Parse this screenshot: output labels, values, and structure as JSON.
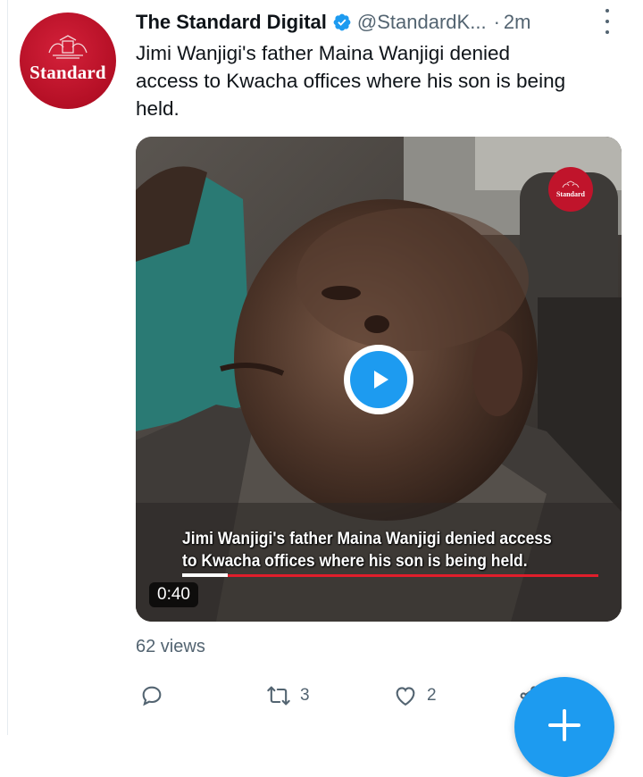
{
  "tweet": {
    "author_name": "The Standard Digital",
    "author_handle": "@StandardK...",
    "separator": "·",
    "time_ago": "2m",
    "avatar_text": "Standard",
    "text": "Jimi Wanjigi's father Maina Wanjigi denied\naccess to Kwacha offices where his son is being\nheld.",
    "views": "62 views"
  },
  "video": {
    "watermark_text": "Standard",
    "caption": "Jimi Wanjigi's father Maina Wanjigi denied access\nto Kwacha offices where his son is being held.",
    "duration": "0:40",
    "progress_fraction": 0.11
  },
  "actions": {
    "reply_count": "",
    "retweet_count": "3",
    "like_count": "2"
  },
  "icons": [
    "verified-icon",
    "more-icon",
    "play-icon",
    "reply-icon",
    "retweet-icon",
    "like-icon",
    "share-icon",
    "compose-icon"
  ],
  "colors": {
    "accent": "#1d9bf0",
    "brand_red": "#b40f25",
    "muted_text": "#536471",
    "caption_line": "#e01e2b"
  }
}
